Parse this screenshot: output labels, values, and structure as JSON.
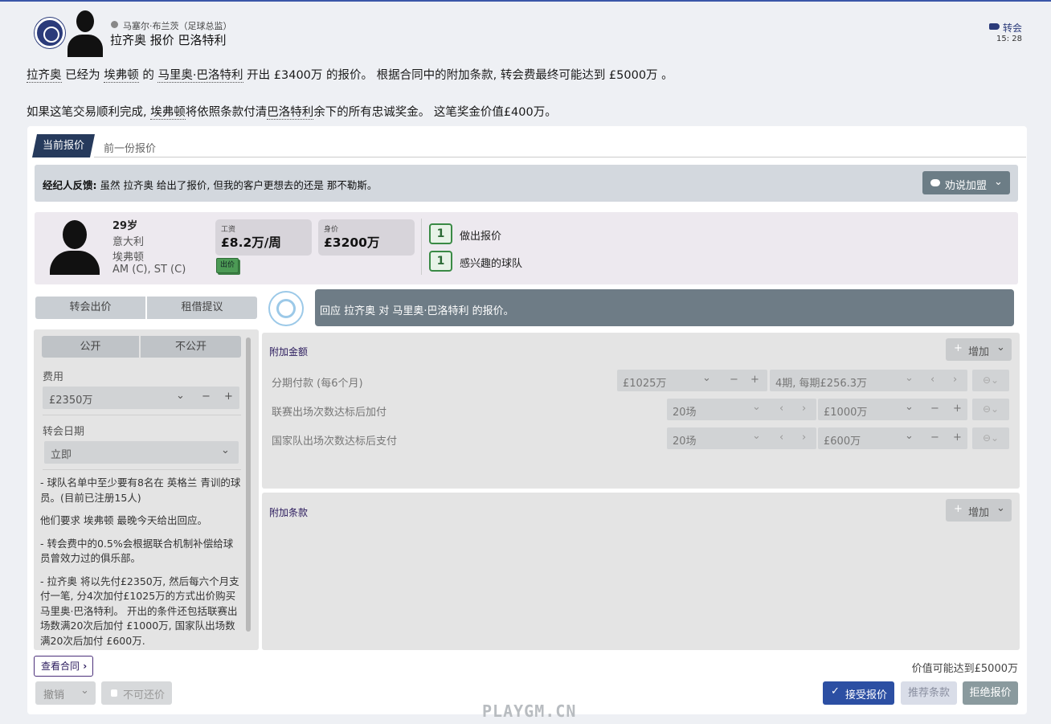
{
  "header": {
    "sender": "马塞尔·布兰茨（足球总监）",
    "title": "拉齐奥 报价 巴洛特利",
    "category": "转会",
    "time": "15: 28"
  },
  "body": {
    "line1": [
      "拉齐奥",
      " 已经为 ",
      "埃弗顿",
      " 的 ",
      "马里奥·巴洛特利",
      " 开出 £3400万 的报价。 根据合同中的附加条款, 转会费最终可能达到 £5000万 。"
    ],
    "line2": [
      "如果这笔交易顺利完成, ",
      "埃弗顿",
      "将依照条款付清",
      "巴洛特利",
      "余下的所有忠诚奖金。 这笔奖金价值£400万。"
    ]
  },
  "tabs": {
    "current": "当前报价",
    "previous": "前一份报价"
  },
  "agent": {
    "label": "经纪人反馈:",
    "text": " 虽然 拉齐奥 给出了报价, 但我的客户更想去的还是 那不勒斯。",
    "button": "劝说加盟"
  },
  "player": {
    "age": "29岁",
    "nation": "意大利",
    "club": "埃弗顿",
    "positions": "AM (C), ST (C)",
    "wage_label": "工资",
    "wage": "£8.2万/周",
    "value_label": "身价",
    "value": "£3200万",
    "offer_tag": "出价",
    "offers_count": "1",
    "offers_label": "做出报价",
    "interested_count": "1",
    "interested_label": "感兴趣的球队"
  },
  "segments": {
    "transfer": "转会出价",
    "loan": "租借提议",
    "public": "公开",
    "private": "不公开"
  },
  "response": "回应 拉齐奥 对 马里奥·巴洛特利 的报价。",
  "left": {
    "fee_label": "费用",
    "fee": "£2350万",
    "date_label": "转会日期",
    "date": "立即",
    "notes": [
      "- 球队名单中至少要有8名在 英格兰 青训的球员。(目前已注册15人)",
      "他们要求 埃弗顿 最晚今天给出回应。",
      "- 转会费中的0.5%会根据联合机制补偿给球员曾效力过的俱乐部。",
      "- 拉齐奥 将以先付£2350万, 然后每六个月支付一笔, 分4次加付£1025万的方式出价购买 马里奥·巴洛特利。 开出的条件还包括联赛出场数满20次后加付 £1000万, 国家队出场数满20次后加付 £600万."
    ]
  },
  "extras": {
    "title": "附加金额",
    "add": "增加",
    "rows": [
      {
        "label": "分期付款 (每6个月)",
        "a": "£1025万",
        "b": "4期, 每期£256.3万"
      },
      {
        "label": "联赛出场次数达标后加付",
        "a": "20场",
        "b": "£1000万"
      },
      {
        "label": "国家队出场次数达标后支付",
        "a": "20场",
        "b": "£600万"
      }
    ]
  },
  "clauses": {
    "title": "附加条款",
    "add": "增加"
  },
  "footer": {
    "contract": "查看合同",
    "value_note": "价值可能达到£5000万",
    "withdraw": "撤销",
    "no_counter": "不可还价",
    "accept": "接受报价",
    "suggest": "推荐条款",
    "reject": "拒绝报价"
  },
  "watermark": "PLAYGM.CN"
}
